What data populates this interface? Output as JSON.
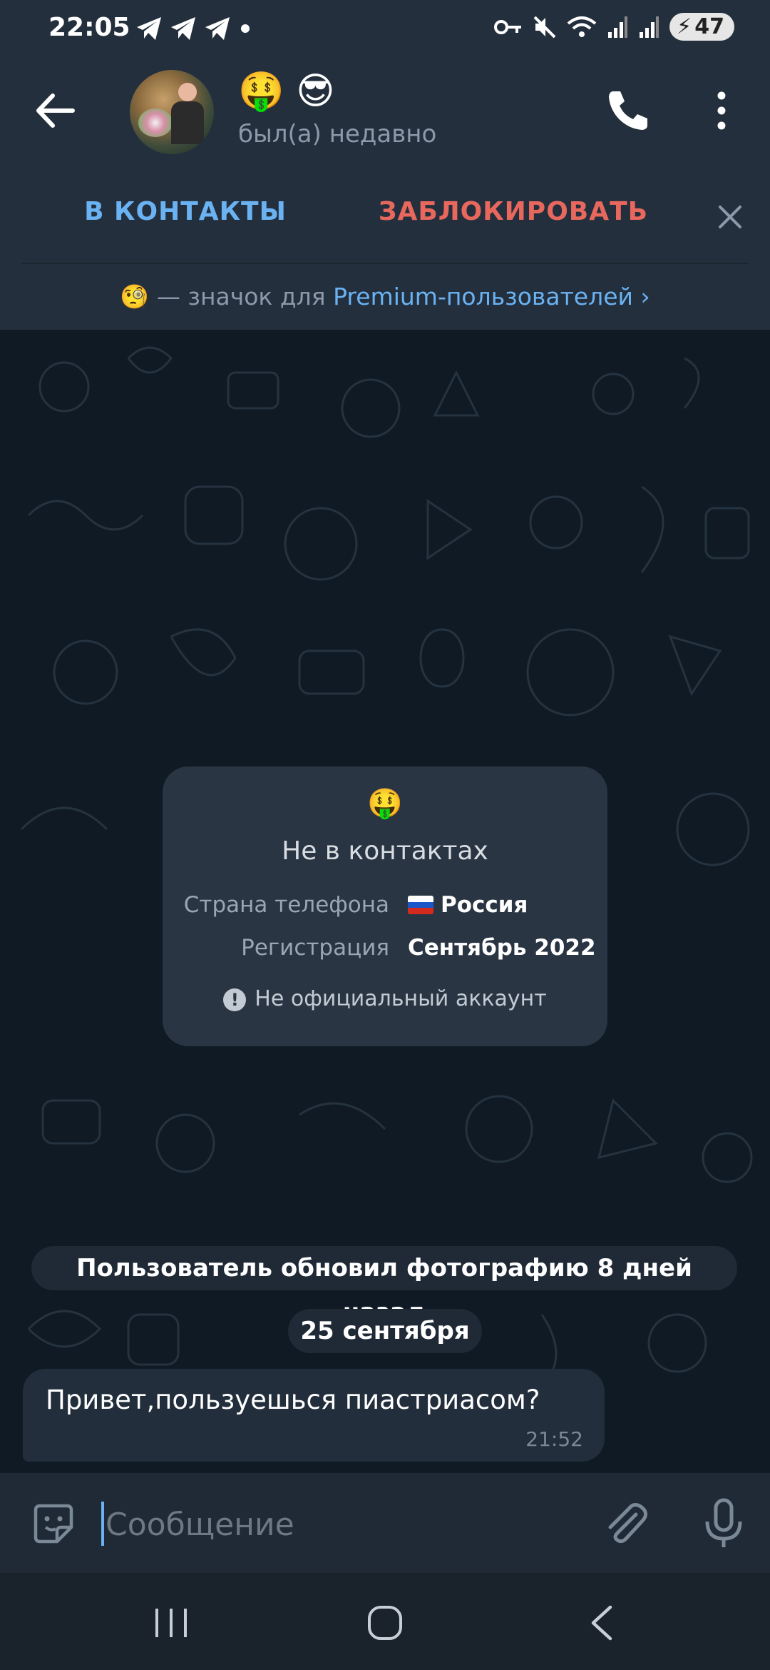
{
  "status_bar": {
    "time": "22:05",
    "battery": "47",
    "left_icons": [
      "telegram-icon",
      "telegram-icon",
      "telegram-icon",
      "dot-icon"
    ],
    "right_icons": [
      "key-icon",
      "mute-icon",
      "wifi-icon",
      "signal-icon",
      "signal-icon",
      "battery-icon"
    ]
  },
  "header": {
    "back_icon": "arrow-left-icon",
    "contact_name": "🤑 😎",
    "status": "был(а) недавно",
    "call_icon": "phone-icon",
    "more_icon": "more-vert-icon"
  },
  "actions": {
    "add_contact": "В КОНТАКТЫ",
    "block": "ЗАБЛОКИРОВАТЬ",
    "close_icon": "close-icon"
  },
  "premium_notice": {
    "emoji": "🧐",
    "text": " — значок для ",
    "link": "Premium-пользователей",
    "chevron": "›"
  },
  "info_card": {
    "emoji": "🤑",
    "title": "Не в контактах",
    "phone_country_label": "Страна телефона",
    "phone_country_value": "Россия",
    "registration_label": "Регистрация",
    "registration_value": "Сентябрь 2022",
    "note": "Не официальный аккаунт",
    "note_icon": "!"
  },
  "service_messages": {
    "photo_update": "Пользователь обновил фотографию 8 дней назад",
    "date": "25 сентября"
  },
  "messages": [
    {
      "text": "Привет,пользуешься пиастриасом?",
      "time": "21:52"
    }
  ],
  "input": {
    "placeholder": "Сообщение",
    "emoji_icon": "sticker-icon",
    "attach_icon": "paperclip-icon",
    "mic_icon": "microphone-icon"
  },
  "nav_bar": {
    "icons": [
      "recents-icon",
      "home-icon",
      "back-icon"
    ]
  },
  "colors": {
    "background": "#17212b",
    "header": "#242f3d",
    "accent_blue": "#6ab2f2",
    "danger_red": "#e8685d",
    "chat_bg": "#0f1a24"
  }
}
